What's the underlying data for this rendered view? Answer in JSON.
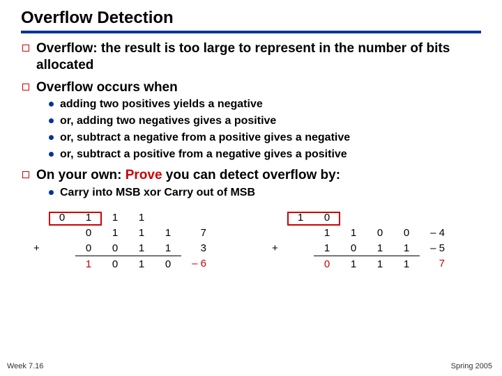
{
  "title": "Overflow Detection",
  "bullets": {
    "intro": "Overflow:  the result is too large to represent in the number of bits allocated",
    "occurs": "Overflow occurs when",
    "sub": [
      "adding two positives yields a negative",
      "or, adding two negatives gives a positive",
      "or, subtract a negative from a positive gives a negative",
      "or, subtract a positive from a negative gives a positive"
    ],
    "own_prefix": "On your own: ",
    "own_red": "Prove",
    "own_suffix": " you can detect overflow by:",
    "carry": "Carry into MSB xor Carry out of MSB"
  },
  "left": {
    "carry": [
      "0",
      "1",
      "1",
      "1"
    ],
    "a": [
      "0",
      "1",
      "1",
      "1"
    ],
    "a_dec": "7",
    "op": "+",
    "b": [
      "0",
      "0",
      "1",
      "1"
    ],
    "b_dec": "3",
    "r": [
      "1",
      "0",
      "1",
      "0"
    ],
    "r_dec": "– 6"
  },
  "right": {
    "carry": [
      "1",
      "0"
    ],
    "a": [
      "1",
      "1",
      "0",
      "0"
    ],
    "a_dec": "– 4",
    "op": "+",
    "b": [
      "1",
      "0",
      "1",
      "1"
    ],
    "b_dec": "– 5",
    "r": [
      "0",
      "1",
      "1",
      "1"
    ],
    "r_dec": "7"
  },
  "footer": {
    "left": "Week 7.16",
    "right": "Spring 2005"
  }
}
